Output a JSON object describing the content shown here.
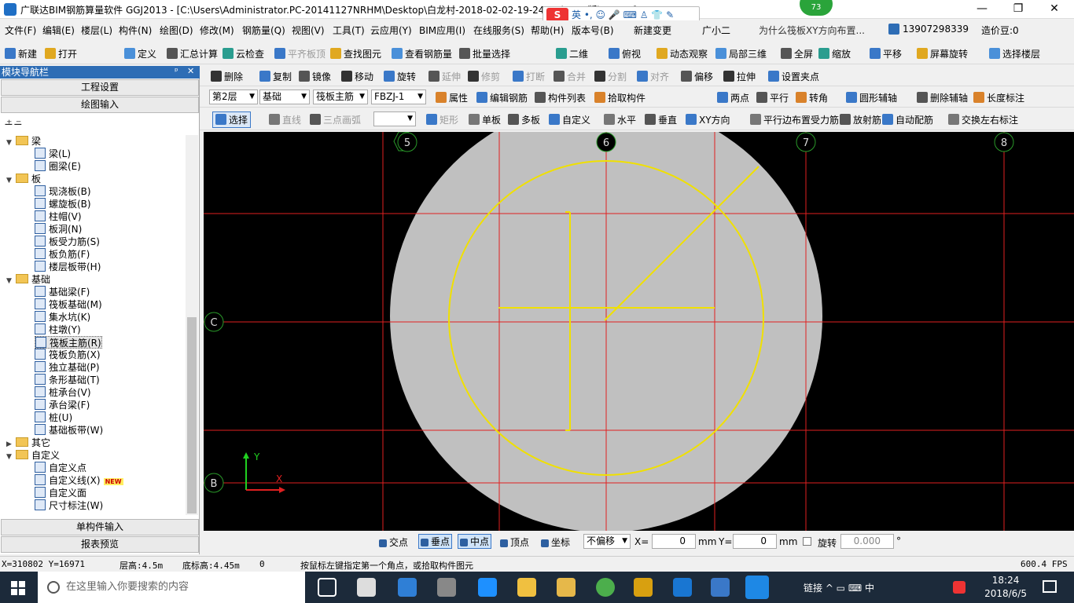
{
  "window": {
    "title": "广联达BIM钢筋算量软件 GGJ2013 - [C:\\Users\\Administrator.PC-20141127NRHM\\Desktop\\白龙村-2018-02-02-19-24-35(3666版).GGJ12]",
    "min": "—",
    "max": "❐",
    "close": "✕"
  },
  "ime": {
    "logo": "S",
    "text": "英 •, ☺ 🎤 ⌨ ♙ 👕 ✎"
  },
  "notify_badge": "73",
  "menu": [
    "文件(F)",
    "编辑(E)",
    "楼层(L)",
    "构件(N)",
    "绘图(D)",
    "修改(M)",
    "钢筋量(Q)",
    "视图(V)",
    "工具(T)",
    "云应用(Y)",
    "BIM应用(I)",
    "在线服务(S)",
    "帮助(H)",
    "版本号(B)",
    "新建变更",
    "广小二"
  ],
  "menu_ad": "为什么筏板XY方向布置...",
  "menu_phone": "13907298339",
  "menu_coins": "造价豆:0",
  "toolbar1": [
    "新建",
    "打开",
    "定义",
    "汇总计算",
    "云检查",
    "平齐板顶",
    "查找图元",
    "查看钢筋量",
    "批量选择",
    "二维",
    "俯视",
    "动态观察",
    "局部三维",
    "全屏",
    "缩放",
    "平移",
    "屏幕旋转",
    "选择楼层"
  ],
  "toolbar2": [
    "删除",
    "复制",
    "镜像",
    "移动",
    "旋转",
    "延伸",
    "修剪",
    "打断",
    "合并",
    "分割",
    "对齐",
    "偏移",
    "拉伸",
    "设置夹点"
  ],
  "toolbar3": {
    "floor": "第2层",
    "category": "基础",
    "type": "筏板主筋",
    "member": "FBZJ-1",
    "items": [
      "属性",
      "编辑钢筋",
      "构件列表",
      "拾取构件",
      "两点",
      "平行",
      "转角",
      "圆形辅轴",
      "删除辅轴",
      "长度标注"
    ]
  },
  "toolbar4": [
    "选择",
    "直线",
    "三点画弧",
    "矩形",
    "单板",
    "多板",
    "自定义",
    "水平",
    "垂直",
    "XY方向",
    "平行边布置受力筋",
    "放射筋",
    "自动配筋",
    "交换左右标注"
  ],
  "nav": {
    "header": "模块导航栏",
    "pin": "ᵖ",
    "close": "✕",
    "btn_project": "工程设置",
    "btn_draw": "绘图输入",
    "tree": [
      {
        "label": "梁",
        "folder": true,
        "level": 0
      },
      {
        "label": "梁(L)",
        "level": 1
      },
      {
        "label": "圈梁(E)",
        "level": 1
      },
      {
        "label": "板",
        "folder": true,
        "level": 0
      },
      {
        "label": "现浇板(B)",
        "level": 1
      },
      {
        "label": "螺旋板(B)",
        "level": 1
      },
      {
        "label": "柱帽(V)",
        "level": 1
      },
      {
        "label": "板洞(N)",
        "level": 1
      },
      {
        "label": "板受力筋(S)",
        "level": 1
      },
      {
        "label": "板负筋(F)",
        "level": 1
      },
      {
        "label": "楼层板带(H)",
        "level": 1
      },
      {
        "label": "基础",
        "folder": true,
        "level": 0
      },
      {
        "label": "基础梁(F)",
        "level": 1
      },
      {
        "label": "筏板基础(M)",
        "level": 1
      },
      {
        "label": "集水坑(K)",
        "level": 1
      },
      {
        "label": "柱墩(Y)",
        "level": 1
      },
      {
        "label": "筏板主筋(R)",
        "level": 1,
        "selected": true
      },
      {
        "label": "筏板负筋(X)",
        "level": 1
      },
      {
        "label": "独立基础(P)",
        "level": 1
      },
      {
        "label": "条形基础(T)",
        "level": 1
      },
      {
        "label": "桩承台(V)",
        "level": 1
      },
      {
        "label": "承台梁(F)",
        "level": 1
      },
      {
        "label": "桩(U)",
        "level": 1
      },
      {
        "label": "基础板带(W)",
        "level": 1
      },
      {
        "label": "其它",
        "folder": true,
        "level": 0,
        "collapsed": true
      },
      {
        "label": "自定义",
        "folder": true,
        "level": 0
      },
      {
        "label": "自定义点",
        "level": 1
      },
      {
        "label": "自定义线(X)",
        "level": 1,
        "new": true
      },
      {
        "label": "自定义面",
        "level": 1
      },
      {
        "label": "尺寸标注(W)",
        "level": 1
      }
    ],
    "new_tag": "NEW",
    "btn_single": "单构件输入",
    "btn_report": "报表预览"
  },
  "canvas": {
    "axis_labels": [
      "5",
      "6",
      "7",
      "8",
      "C",
      "B"
    ],
    "y_label": "Y",
    "x_label": "X"
  },
  "snapbar": {
    "items": [
      "交点",
      "垂点",
      "中点",
      "顶点",
      "坐标"
    ],
    "offset": "不偏移",
    "x_label": "X=",
    "x_value": "0",
    "unit1": "mm",
    "y_label": "Y=",
    "y_value": "0",
    "unit2": "mm",
    "rotate": "旋转",
    "rotate_value": "0.000",
    "deg": "°"
  },
  "status": {
    "coords": "X=310802 Y=16971",
    "floor_height": "层高:4.5m",
    "base_height": "底标高:4.45m",
    "count": "0",
    "hint": "按鼠标左键指定第一个角点，或拾取构件图元",
    "fps": "600.4 FPS"
  },
  "taskbar": {
    "search": "在这里输入你要搜索的内容",
    "tray": "链接 ^ ▭ ⌨ 中",
    "time": "18:24",
    "date": "2018/6/5"
  }
}
